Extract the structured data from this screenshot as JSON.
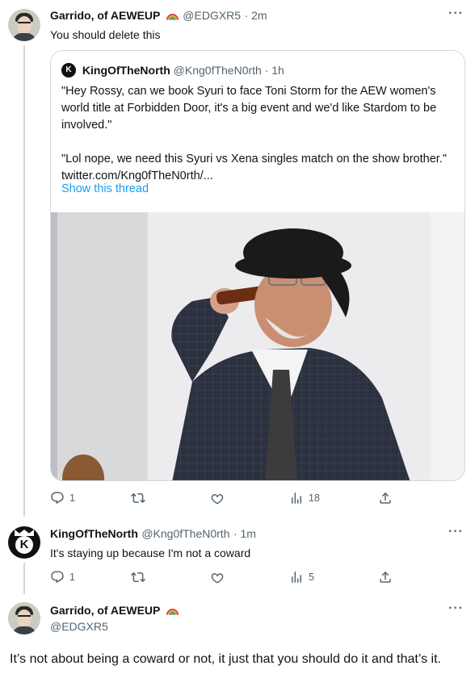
{
  "tweet1": {
    "name": "Garrido, of AEWEUP",
    "handle": "@EDGXR5",
    "time": "· 2m",
    "more": "···",
    "text": "You should delete this",
    "quote": {
      "name": "KingOfTheNorth",
      "handle": "@Kng0fTheN0rth",
      "time": "· 1h",
      "para1": "\"Hey Rossy, can we book Syuri to face Toni Storm for the AEW women's world title at Forbidden Door, it's a big event and we'd like Stardom to be involved.\"",
      "para2": "\"Lol nope, we need this Syuri vs Xena singles match on the show brother.\"  twitter.com/Kng0fTheN0rth/...",
      "show_thread": "Show this thread"
    },
    "actions": {
      "replies": "1",
      "retweets": "",
      "likes": "",
      "views": "18"
    }
  },
  "tweet2": {
    "name": "KingOfTheNorth",
    "handle": "@Kng0fTheN0rth",
    "time": "· 1m",
    "more": "···",
    "text": "It's staying up because I'm not a coward",
    "actions": {
      "replies": "1",
      "retweets": "",
      "likes": "",
      "views": "5"
    }
  },
  "tweet3": {
    "name": "Garrido, of AEWEUP",
    "handle": "@EDGXR5",
    "more": "···",
    "text": "It’s not about being a coward or not, it just that you should do it and that’s it."
  },
  "colors": {
    "accent": "#1d9bf0",
    "muted": "#536471",
    "border": "#cfd9de"
  },
  "icons": [
    "reply-icon",
    "retweet-icon",
    "like-icon",
    "views-icon",
    "share-icon",
    "more-icon",
    "rainbow-icon"
  ]
}
